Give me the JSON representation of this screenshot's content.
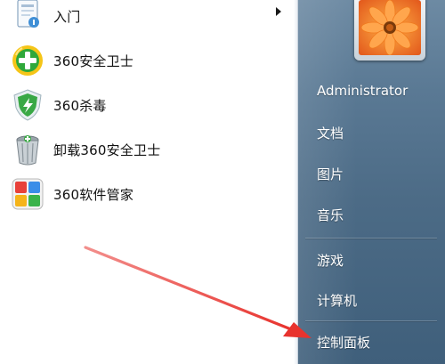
{
  "left_menu": {
    "items": [
      {
        "label": "入门",
        "icon": "getting-started-icon",
        "has_submenu": true
      },
      {
        "label": "360安全卫士",
        "icon": "360-safeguard-icon"
      },
      {
        "label": "360杀毒",
        "icon": "360-antivirus-icon"
      },
      {
        "label": "卸载360安全卫士",
        "icon": "uninstall-trash-icon"
      },
      {
        "label": "360软件管家",
        "icon": "360-software-manager-icon"
      }
    ]
  },
  "right_menu": {
    "user_name": "Administrator",
    "items": [
      {
        "label": "文档"
      },
      {
        "label": "图片"
      },
      {
        "label": "音乐"
      },
      {
        "label": "游戏"
      },
      {
        "label": "计算机"
      },
      {
        "label": "控制面板"
      }
    ],
    "avatar_icon": "flower-avatar-icon"
  },
  "annotation": {
    "arrow_icon": "red-arrow-icon",
    "arrow_color": "#e8332e"
  },
  "colors": {
    "right_pane_top": "#6d8aa3",
    "right_pane_bottom": "#3f5f7b",
    "text_dark": "#111111",
    "text_light": "#ffffff"
  }
}
